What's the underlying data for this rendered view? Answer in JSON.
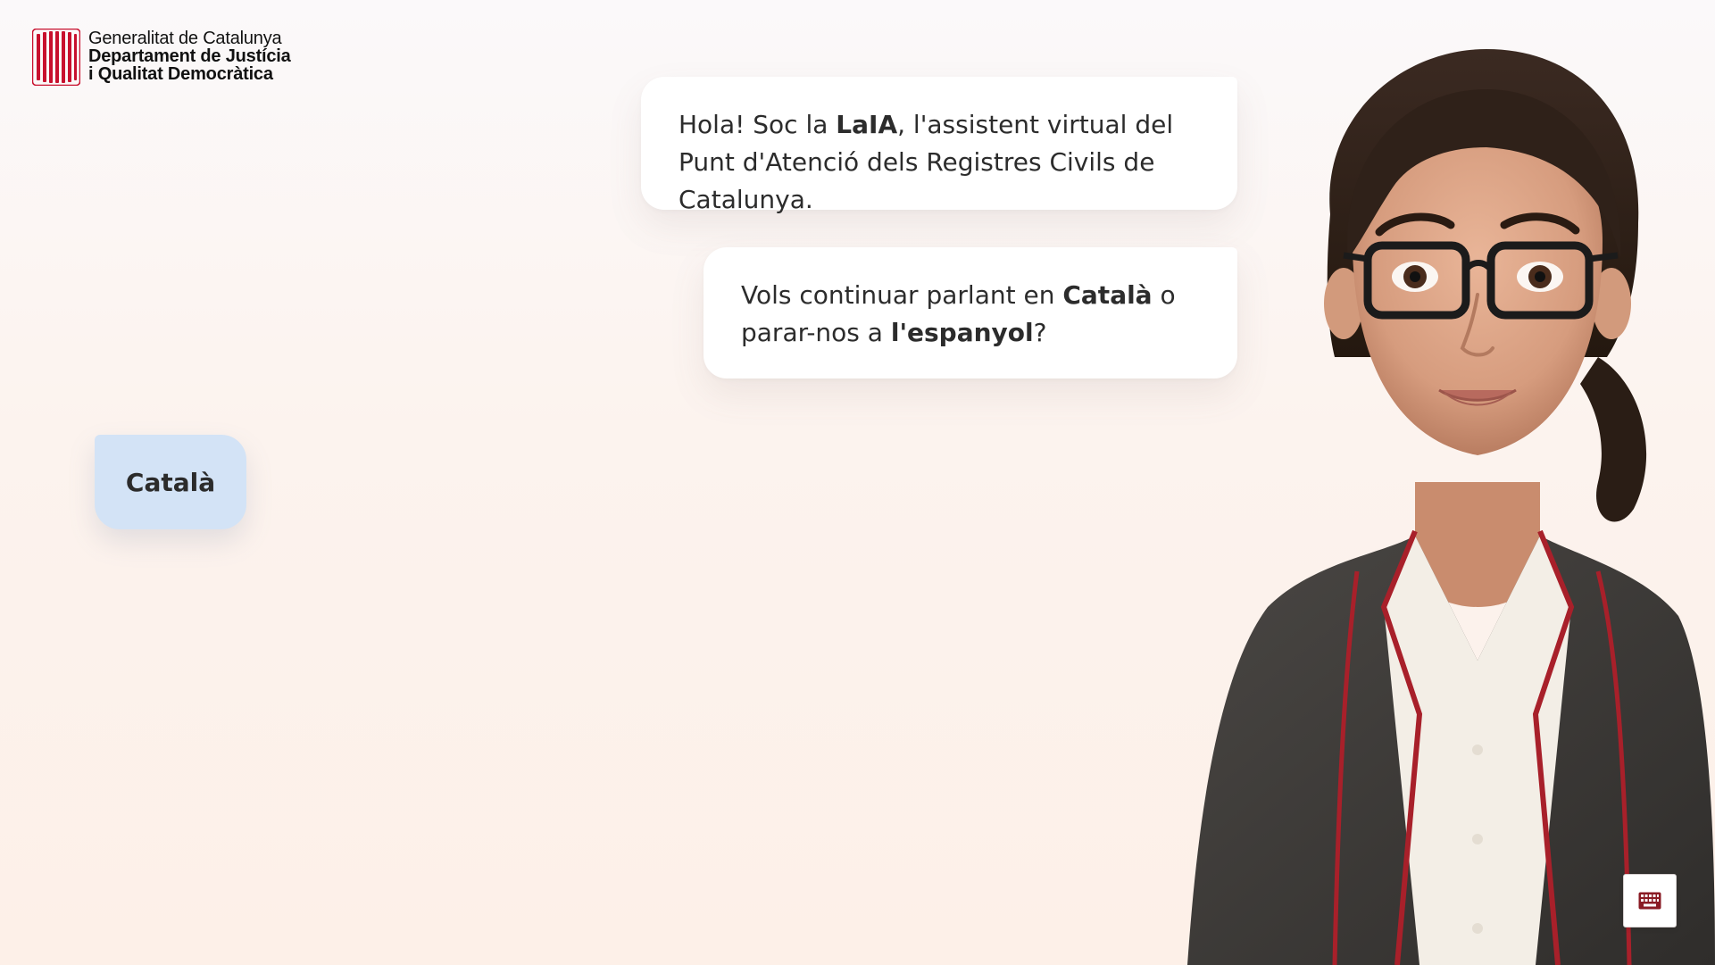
{
  "header": {
    "logo_line1": "Generalitat de Catalunya",
    "logo_line2": "Departament de Justícia",
    "logo_line3": "i Qualitat Democràtica"
  },
  "chat": {
    "message1": {
      "part1": "Hola! Soc la ",
      "bold1": "LaIA",
      "part2": ", l'assistent virtual del Punt d'Atenció dels Registres Civils de Catalunya."
    },
    "message2": {
      "part1": "Vols continuar parlant en ",
      "bold1": "Català",
      "part2": " o parar-nos a ",
      "bold2": "l'espanyol",
      "part3": "?"
    }
  },
  "options": {
    "catala_label": "Català"
  },
  "controls": {
    "keyboard_icon": "keyboard-icon"
  },
  "colors": {
    "brand_red": "#c8102e",
    "option_bg": "#d3e3f6",
    "bubble_bg": "#ffffff"
  }
}
